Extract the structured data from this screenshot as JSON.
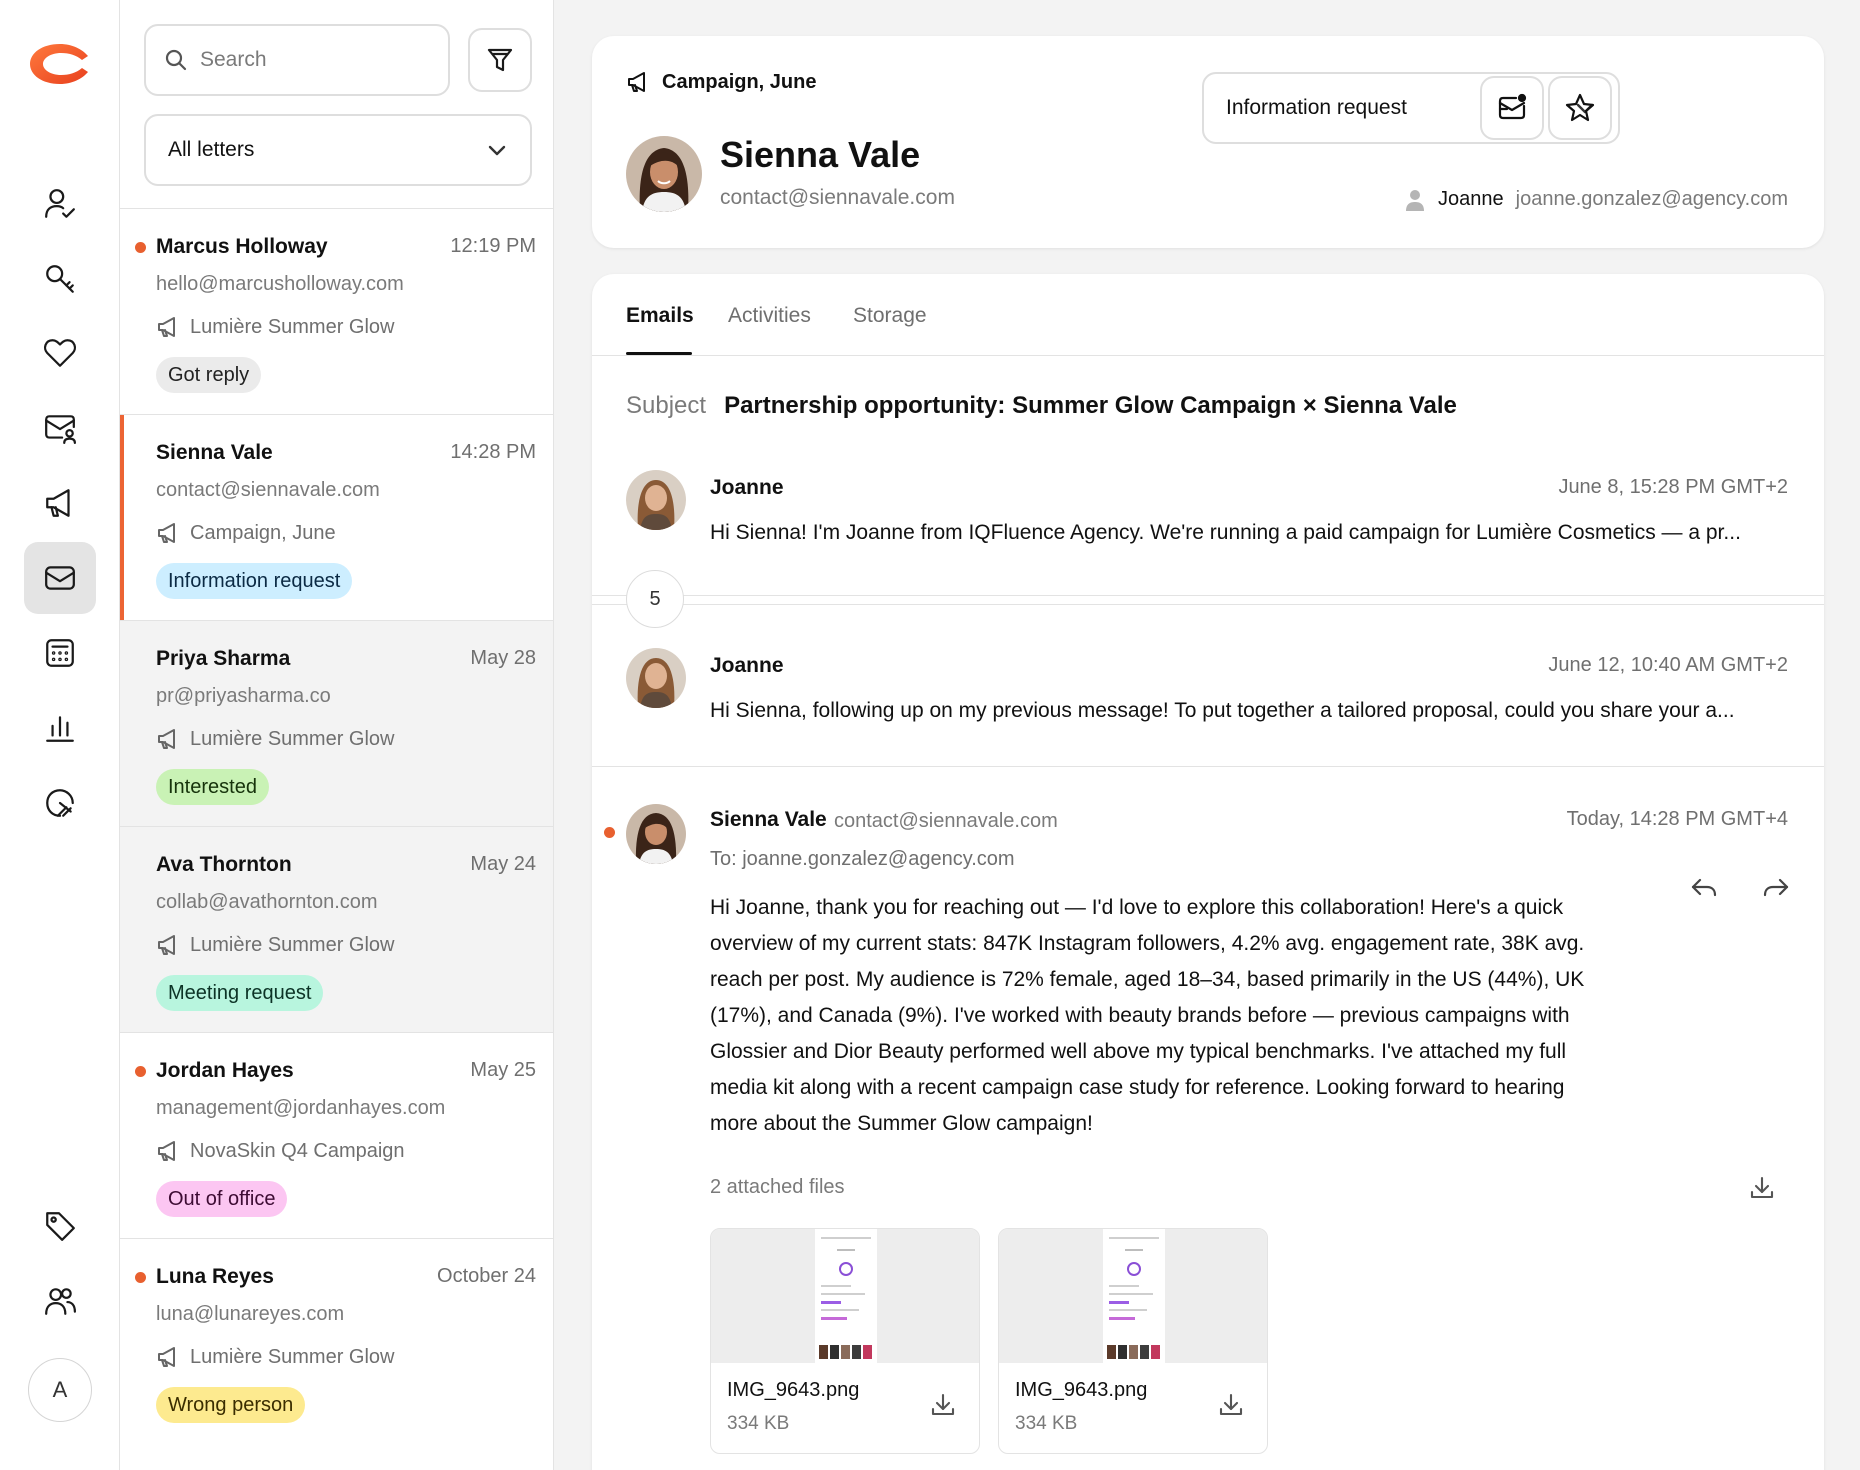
{
  "nav": {
    "items": [
      {
        "icon": "user-check-icon",
        "active": false
      },
      {
        "icon": "search-people-icon",
        "active": false
      },
      {
        "icon": "heart-icon",
        "active": false
      },
      {
        "icon": "mail-user-icon",
        "active": false
      },
      {
        "icon": "megaphone-icon",
        "active": false
      },
      {
        "icon": "inbox-icon",
        "active": true
      },
      {
        "icon": "calculator-icon",
        "active": false
      },
      {
        "icon": "bar-chart-icon",
        "active": false
      },
      {
        "icon": "speed-icon",
        "active": false
      }
    ],
    "bottom_items": [
      {
        "icon": "tag-icon"
      },
      {
        "icon": "users-icon"
      }
    ],
    "avatar_initial": "A"
  },
  "list": {
    "search_placeholder": "Search",
    "filter_dropdown": "All letters",
    "threads": [
      {
        "name": "Marcus Holloway",
        "time": "12:19 PM",
        "email": "hello@marcusholloway.com",
        "campaign": "Lumière Summer Glow",
        "badge": "Got reply",
        "badge_bg": "#ebebeb",
        "badge_color": "#222222",
        "unread": true,
        "state": "unread"
      },
      {
        "name": "Sienna Vale",
        "time": "14:28 PM",
        "email": "contact@siennavale.com",
        "campaign": "Campaign, June",
        "badge": "Information request",
        "badge_bg": "#cdeeff",
        "badge_color": "#0b2a44",
        "unread": false,
        "state": "selected"
      },
      {
        "name": "Priya Sharma",
        "time": "May 28",
        "email": "pr@priyasharma.co",
        "campaign": "Lumière Summer Glow",
        "badge": "Interested",
        "badge_bg": "#c9f2b5",
        "badge_color": "#16330b",
        "unread": false,
        "state": "read"
      },
      {
        "name": "Ava Thornton",
        "time": "May 24",
        "email": "collab@avathornton.com",
        "campaign": "Lumière Summer Glow",
        "badge": "Meeting request",
        "badge_bg": "#b8f5de",
        "badge_color": "#0c3326",
        "unread": false,
        "state": "read"
      },
      {
        "name": "Jordan Hayes",
        "time": "May 25",
        "email": "management@jordanhayes.com",
        "campaign": "NovaSkin Q4 Campaign",
        "badge": "Out of office",
        "badge_bg": "#fcc6f2",
        "badge_color": "#3d0b33",
        "unread": true,
        "state": "unread"
      },
      {
        "name": "Luna Reyes",
        "time": "October 24",
        "email": "luna@lunareyes.com",
        "campaign": "Lumière Summer Glow",
        "badge": "Wrong person",
        "badge_bg": "#fdea8f",
        "badge_color": "#3a2d00",
        "unread": true,
        "state": "unread"
      }
    ]
  },
  "header": {
    "campaign": "Campaign, June",
    "contact_name": "Sienna Vale",
    "contact_email": "contact@siennavale.com",
    "status_select": "Information request",
    "assignee_name": "Joanne",
    "assignee_email": "joanne.gonzalez@agency.com"
  },
  "tabs": [
    "Emails",
    "Activities",
    "Storage"
  ],
  "active_tab": "Emails",
  "mail": {
    "subject_label": "Subject",
    "subject": "Partnership opportunity: Summer Glow Campaign × Sienna Vale",
    "messages": [
      {
        "from": "Joanne",
        "date": "June 8,  15:28 PM  GMT+2",
        "snippet": "Hi Sienna! I'm Joanne from IQFluence Agency. We're running a paid campaign for Lumière Cosmetics — a pr..."
      },
      {
        "from": "Joanne",
        "date": "June 12,  10:40 AM  GMT+2",
        "snippet": "Hi Sienna, following up on my previous message! To put together a tailored proposal, could you share your a..."
      }
    ],
    "collapsed_count": "5",
    "open_message": {
      "from": "Sienna Vale",
      "from_email": "contact@siennavale.com",
      "date": "Today,  14:28 PM  GMT+4",
      "to": "To: joanne.gonzalez@agency.com",
      "body": "Hi Joanne, thank you for reaching out — I'd love to explore this collaboration! Here's a quick overview of my current stats: 847K Instagram followers, 4.2% avg. engagement rate, 38K avg. reach per post. My audience is 72% female, aged 18–34, based primarily in the US (44%), UK (17%), and Canada (9%). I've worked with beauty brands before — previous campaigns with Glossier and Dior Beauty performed well above my typical benchmarks. I've attached my full media kit along with a recent campaign case study for reference. Looking forward to hearing more about the Summer Glow campaign!",
      "attachments_label": "2 attached files",
      "attachments": [
        {
          "name": "IMG_9643.png",
          "size": "334 KB"
        },
        {
          "name": "IMG_9643.png",
          "size": "334 KB"
        }
      ]
    }
  },
  "colors": {
    "accent": "#ec6434",
    "unread_dot": "#e8602f"
  }
}
